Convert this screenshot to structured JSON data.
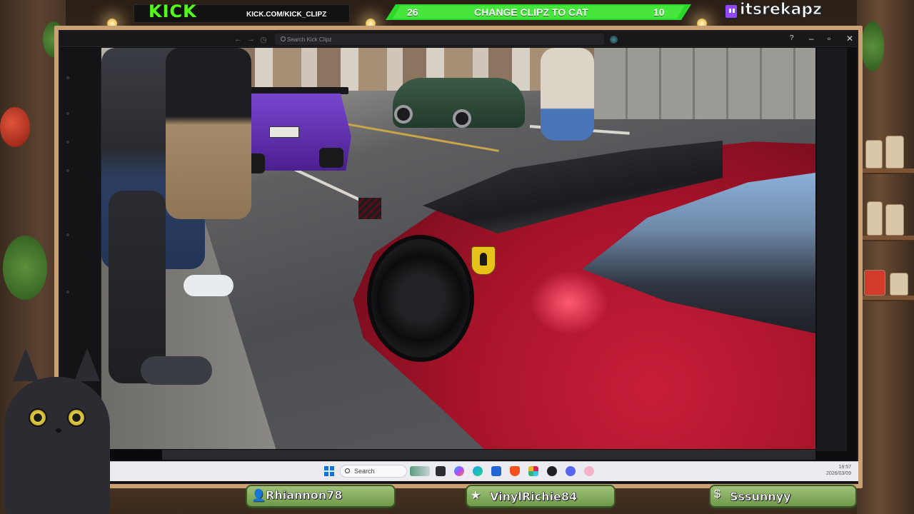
{
  "overlay": {
    "kick_logo": "KICK",
    "kick_url": "KICK.COM/KICK_CLIPZ",
    "goal": {
      "left_count": "26",
      "label": "CHANGE CLIPZ TO CAT",
      "right_count": "10"
    },
    "handle": "itsrekapz"
  },
  "browser": {
    "search_placeholder": "Search Kick Clipz",
    "nav": {
      "back_icon": "arrow-left-icon",
      "forward_icon": "arrow-right-icon",
      "history_icon": "history-icon"
    },
    "controls": {
      "help": "?",
      "minimize": "–",
      "maximize": "▫",
      "close": "✕"
    }
  },
  "video": {
    "progress_fraction": 0.085
  },
  "taskbar": {
    "search_label": "Search",
    "clock_time": "18:57",
    "clock_date": "2026/03/09",
    "apps": [
      "widgets-icon",
      "file-explorer-icon",
      "copilot-icon",
      "edge-icon",
      "store-icon",
      "brave-icon",
      "slack-icon",
      "obs-icon",
      "discord-icon",
      "vtube-icon"
    ]
  },
  "chat_plates": [
    {
      "icon": "user-icon",
      "name": "Rhiannon78"
    },
    {
      "icon": "star-icon",
      "name": "VinylRichie84"
    },
    {
      "icon": "dollar-icon",
      "name": "Sssunnyy"
    }
  ],
  "colors": {
    "kick_green": "#53fc18",
    "goal_green": "#46e63c",
    "plate_green": "#8bb566",
    "ferrari_red": "#c81e3a"
  }
}
